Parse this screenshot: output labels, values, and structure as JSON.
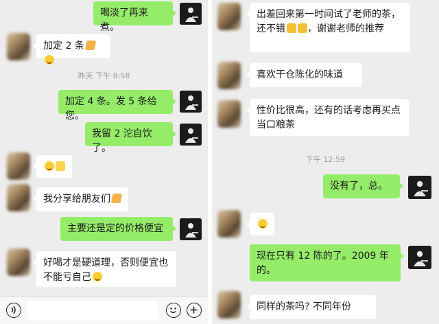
{
  "left": {
    "messages": [
      {
        "id": "m1",
        "side": "out",
        "text": "喝淡了再来煮。"
      },
      {
        "id": "m2",
        "side": "in",
        "text": "加定 2 条",
        "emojis": [
          "pray",
          "smile"
        ]
      },
      {
        "id": "m3",
        "side": "out",
        "text": "加定 4 条。发 5 条给您。"
      },
      {
        "id": "m4",
        "side": "out",
        "text": "我留 2 沱自饮了。"
      },
      {
        "id": "m5",
        "side": "in",
        "text": "",
        "emojis": [
          "grin",
          "ok"
        ]
      },
      {
        "id": "m6",
        "side": "in",
        "text": "我分享给朋友们",
        "emojis": [
          "pray"
        ]
      },
      {
        "id": "m7",
        "side": "out",
        "text": "主要还是定的价格便宜"
      },
      {
        "id": "m8",
        "side": "in",
        "text": "好喝才是硬道理，否则便宜也不能亏自己",
        "emojis": [
          "wink"
        ]
      }
    ],
    "timestamp": "昨天 下午 8:58",
    "input": {
      "voice_icon": "voice-icon",
      "emoji_icon": "emoji-icon",
      "plus_icon": "plus-icon"
    }
  },
  "right": {
    "messages": [
      {
        "id": "r1",
        "side": "in",
        "text": "出差回来第一时间试了老师的茶，还不错",
        "emojis": [
          "thumb",
          "thumb"
        ],
        "text_after": "，谢谢老师的推荐"
      },
      {
        "id": "r2",
        "side": "in",
        "text": "喜欢干仓陈化的味道"
      },
      {
        "id": "r3",
        "side": "in",
        "text": "性价比很高，还有的话考虑再买点当口粮茶"
      },
      {
        "id": "r4",
        "side": "out",
        "text": "没有了，总。"
      },
      {
        "id": "r5",
        "side": "in",
        "text": "",
        "emojis": [
          "cry"
        ]
      },
      {
        "id": "r6",
        "side": "out",
        "text": "现在只有 12 陈的了。2009 年的。"
      },
      {
        "id": "r7",
        "side": "in",
        "text": "同样的茶吗? 不同年份"
      }
    ],
    "timestamp": "下午 12:59"
  },
  "colors": {
    "outgoing": "#95ec69",
    "incoming": "#ffffff",
    "background": "#ededed",
    "timestamp": "#9b9b9b"
  }
}
